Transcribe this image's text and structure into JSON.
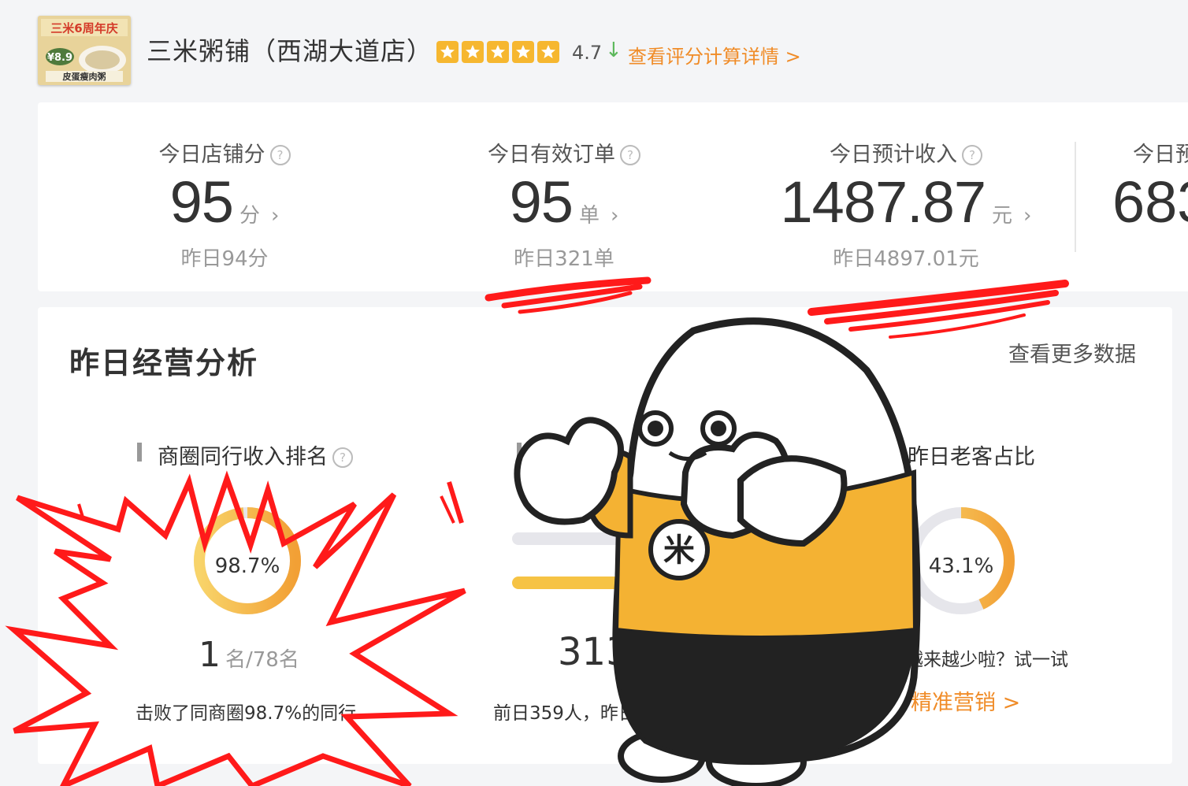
{
  "shop": {
    "logo_promo": "三米6周年庆",
    "logo_price": "¥8.9",
    "logo_dish": "皮蛋瘦肉粥",
    "name": "三米粥铺（西湖大道店）",
    "rating": "4.7",
    "rating_trend": "↓",
    "rating_link": "查看评分计算详情 >",
    "star_count": 5
  },
  "metrics": [
    {
      "label": "今日店铺分",
      "value": "95",
      "unit": "分",
      "yesterday": "昨日94分"
    },
    {
      "label": "今日有效订单",
      "value": "95",
      "unit": "单",
      "yesterday": "昨日321单"
    },
    {
      "label": "今日预计收入",
      "value": "1487.87",
      "unit": "元",
      "yesterday": "昨日4897.01元"
    },
    {
      "label": "今日预",
      "value": "683"
    }
  ],
  "analysis": {
    "title": "昨日经营分析",
    "more_link": "查看更多数据",
    "rank": {
      "title": "商圈同行收入排名",
      "percent": "98.7%",
      "percent_value": 0.987,
      "rank_num": "1",
      "rank_total": "名/78名",
      "beat_text": "击败了同商圈98.7%的同行"
    },
    "customers": {
      "big_value": "313",
      "prev_text": "前日359人，昨日减"
    },
    "repeat": {
      "title": "昨日老客占比",
      "percent": "43.1%",
      "percent_value": 0.431,
      "tip": "客越来越少啦？试一试",
      "marketing": "精准营销 >"
    }
  },
  "sticker": {
    "badge": "米"
  },
  "colors": {
    "accent": "#f6b730",
    "link": "#f08c28",
    "red": "#ff1a1a",
    "ring_track": "#e6e6eb"
  }
}
